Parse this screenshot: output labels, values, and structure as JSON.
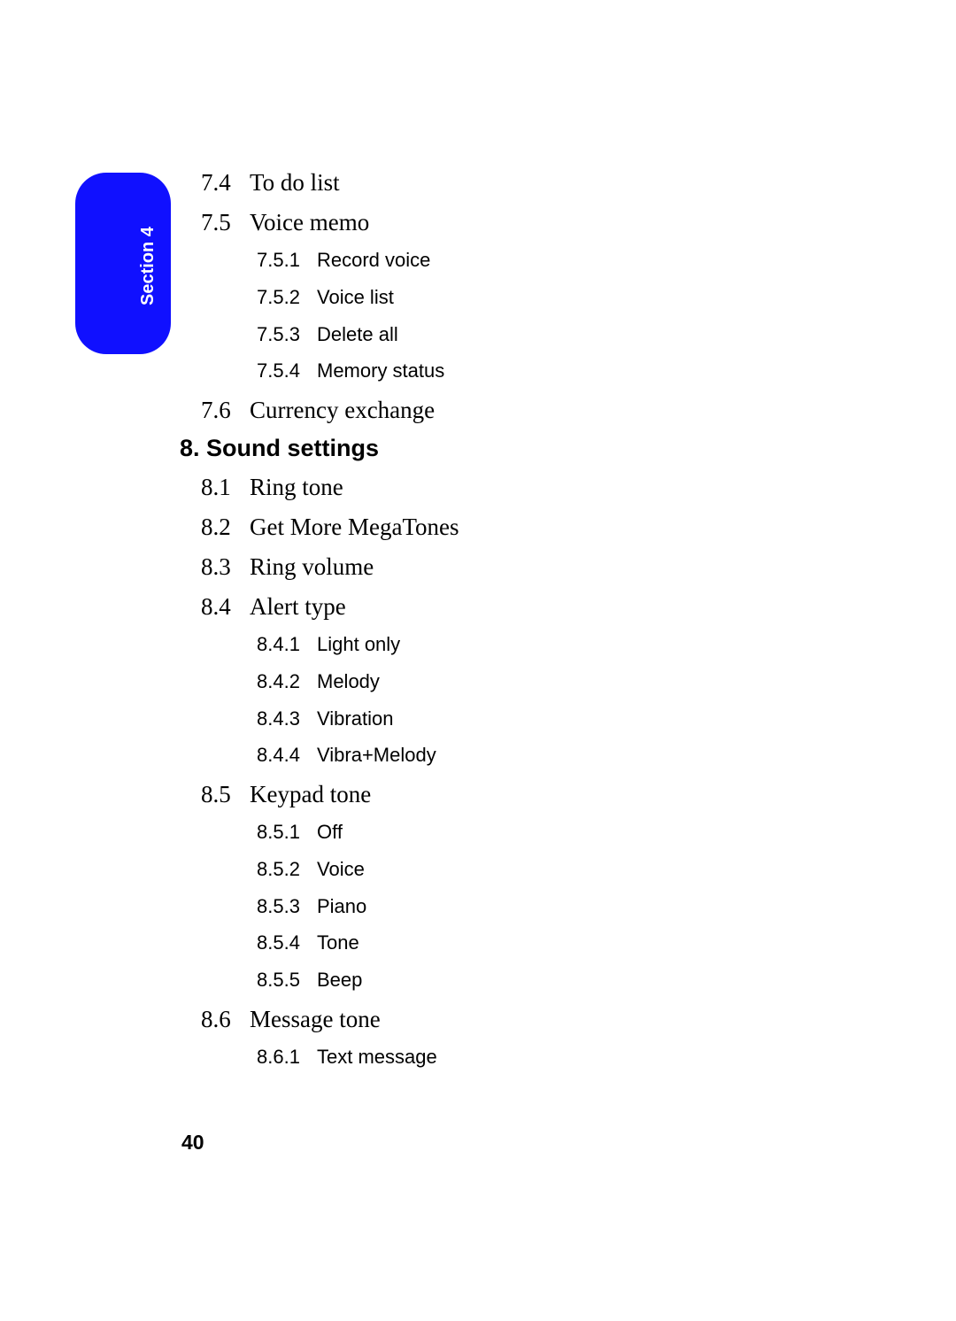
{
  "section_tab": "Section 4",
  "page_number": "40",
  "items": {
    "i0": {
      "num": "7.4",
      "label": "To do list"
    },
    "i1": {
      "num": "7.5",
      "label": "Voice memo"
    },
    "i1_0": {
      "num": "7.5.1",
      "label": "Record voice"
    },
    "i1_1": {
      "num": "7.5.2",
      "label": "Voice list"
    },
    "i1_2": {
      "num": "7.5.3",
      "label": "Delete all"
    },
    "i1_3": {
      "num": "7.5.4",
      "label": "Memory status"
    },
    "i2": {
      "num": "7.6",
      "label": "Currency exchange"
    },
    "h8": "8. Sound settings",
    "i3": {
      "num": "8.1",
      "label": "Ring tone"
    },
    "i4": {
      "num": "8.2",
      "label": "Get More MegaTones"
    },
    "i5": {
      "num": "8.3",
      "label": "Ring volume"
    },
    "i6": {
      "num": "8.4",
      "label": "Alert type"
    },
    "i6_0": {
      "num": "8.4.1",
      "label": "Light only"
    },
    "i6_1": {
      "num": "8.4.2",
      "label": "Melody"
    },
    "i6_2": {
      "num": "8.4.3",
      "label": "Vibration"
    },
    "i6_3": {
      "num": "8.4.4",
      "label": "Vibra+Melody"
    },
    "i7": {
      "num": "8.5",
      "label": "Keypad tone"
    },
    "i7_0": {
      "num": "8.5.1",
      "label": "Off"
    },
    "i7_1": {
      "num": "8.5.2",
      "label": "Voice"
    },
    "i7_2": {
      "num": "8.5.3",
      "label": "Piano"
    },
    "i7_3": {
      "num": "8.5.4",
      "label": "Tone"
    },
    "i7_4": {
      "num": "8.5.5",
      "label": "Beep"
    },
    "i8": {
      "num": "8.6",
      "label": "Message tone"
    },
    "i8_0": {
      "num": "8.6.1",
      "label": "Text message"
    }
  }
}
